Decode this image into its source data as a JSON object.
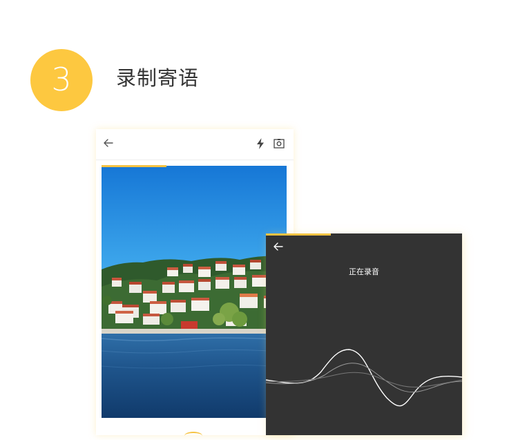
{
  "step": {
    "number": "3",
    "title": "录制寄语"
  },
  "photo_screen": {
    "top_icons": [
      "back-arrow-icon",
      "flash-icon",
      "switch-camera-icon"
    ],
    "recording_progress": 0.35
  },
  "record_screen": {
    "status_text": "正在录音",
    "top_icons": [
      "back-arrow-icon"
    ],
    "recording_progress": 0.33
  },
  "colors": {
    "accent": "#FDC840",
    "progress": "#F6C342",
    "record_bg": "#333333",
    "title_text": "#333333"
  }
}
